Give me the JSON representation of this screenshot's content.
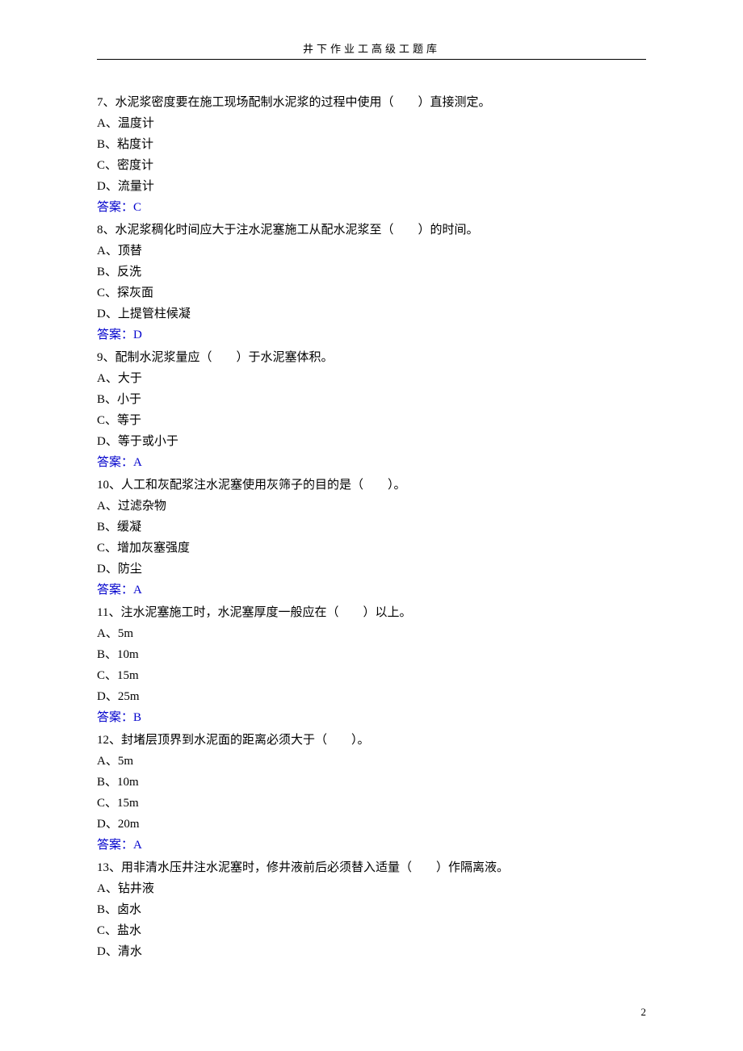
{
  "header": {
    "title": "井下作业工高级工题库"
  },
  "questions": [
    {
      "text": "7、水泥浆密度要在施工现场配制水泥浆的过程中使用（　　）直接测定。",
      "options": [
        "A、温度计",
        "B、粘度计",
        "C、密度计",
        "D、流量计"
      ],
      "answer": "答案：C"
    },
    {
      "text": "8、水泥浆稠化时间应大于注水泥塞施工从配水泥浆至（　　）的时间。",
      "options": [
        "A、顶替",
        "B、反洗",
        "C、探灰面",
        "D、上提管柱候凝"
      ],
      "answer": "答案：D"
    },
    {
      "text": "9、配制水泥浆量应（　　）于水泥塞体积。",
      "options": [
        "A、大于",
        "B、小于",
        "C、等于",
        "D、等于或小于"
      ],
      "answer": "答案：A"
    },
    {
      "text": "10、人工和灰配浆注水泥塞使用灰筛子的目的是（　　）。",
      "options": [
        "A、过滤杂物",
        "B、缓凝",
        "C、增加灰塞强度",
        "D、防尘"
      ],
      "answer": "答案：A"
    },
    {
      "text": "11、注水泥塞施工时，水泥塞厚度一般应在（　　）以上。",
      "options": [
        "A、5m",
        "B、10m",
        "C、15m",
        "D、25m"
      ],
      "answer": "答案：B"
    },
    {
      "text": "12、封堵层顶界到水泥面的距离必须大于（　　）。",
      "options": [
        "A、5m",
        "B、10m",
        "C、15m",
        "D、20m"
      ],
      "answer": "答案：A"
    },
    {
      "text": "13、用非清水压井注水泥塞时，修井液前后必须替入适量（　　）作隔离液。",
      "options": [
        "A、钻井液",
        "B、卤水",
        "C、盐水",
        "D、清水"
      ],
      "answer": ""
    }
  ],
  "footer": {
    "page_number": "2"
  }
}
